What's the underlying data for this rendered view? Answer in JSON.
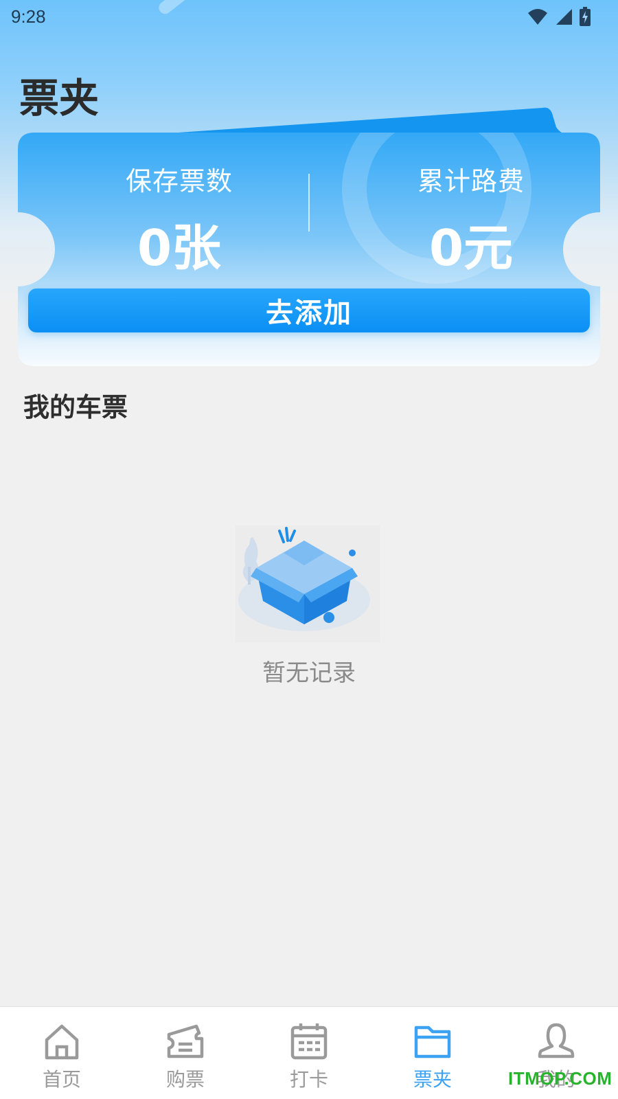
{
  "status_bar": {
    "time": "9:28"
  },
  "page": {
    "title": "票夹"
  },
  "summary": {
    "saved_label": "保存票数",
    "saved_value": "0张",
    "cost_label": "累计路费",
    "cost_value": "0元",
    "add_button": "去添加"
  },
  "tickets": {
    "section_title": "我的车票",
    "empty_text": "暂无记录"
  },
  "bottom_nav": {
    "items": [
      {
        "label": "首页",
        "icon": "home-icon"
      },
      {
        "label": "购票",
        "icon": "ticket-icon"
      },
      {
        "label": "打卡",
        "icon": "calendar-icon"
      },
      {
        "label": "票夹",
        "icon": "folder-icon",
        "active": true
      },
      {
        "label": "我的",
        "icon": "user-icon"
      }
    ]
  },
  "watermark": "ITMOP.COM",
  "colors": {
    "accent": "#1a9af7",
    "active_tab": "#3ea2f2",
    "inactive_tab": "#9a9a9a",
    "background": "#f0f0f0"
  }
}
